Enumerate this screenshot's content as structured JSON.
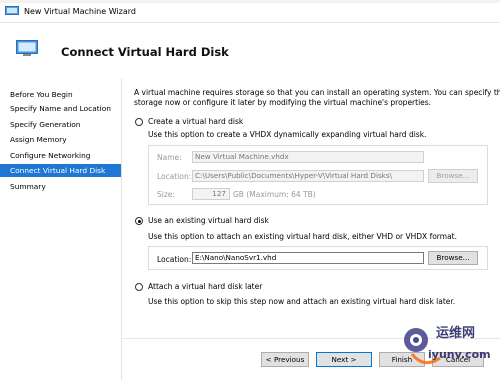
{
  "window": {
    "title": "New Virtual Machine Wizard",
    "top_strip_text": "... ... ...   ..."
  },
  "header": {
    "title": "Connect Virtual Hard Disk"
  },
  "nav": {
    "items": [
      {
        "label": "Before You Begin",
        "active": false
      },
      {
        "label": "Specify Name and Location",
        "active": false
      },
      {
        "label": "Specify Generation",
        "active": false
      },
      {
        "label": "Assign Memory",
        "active": false
      },
      {
        "label": "Configure Networking",
        "active": false
      },
      {
        "label": "Connect Virtual Hard Disk",
        "active": true
      },
      {
        "label": "Summary",
        "active": false
      }
    ]
  },
  "intro": {
    "line1": "A virtual machine requires storage so that you can install an operating system. You can specify the",
    "line2": "storage now or configure it later by modifying the virtual machine's properties."
  },
  "option_create": {
    "label": "Create a virtual hard disk",
    "description": "Use this option to create a VHDX dynamically expanding virtual hard disk.",
    "name_label": "Name:",
    "name_value": "New Virtual Machine.vhdx",
    "location_label": "Location:",
    "location_value": "C:\\Users\\Public\\Documents\\Hyper-V\\Virtual Hard Disks\\",
    "browse_label": "Browse...",
    "size_label": "Size:",
    "size_value": "127",
    "size_unit": "GB (Maximum: 64 TB)",
    "selected": false
  },
  "option_existing": {
    "label": "Use an existing virtual hard disk",
    "description": "Use this option to attach an existing virtual hard disk, either VHD or VHDX format.",
    "location_label": "Location:",
    "location_value": "E:\\Nano\\NanoSvr1.vhd",
    "browse_label": "Browse...",
    "selected": true
  },
  "option_later": {
    "label": "Attach a virtual hard disk later",
    "description": "Use this option to skip this step now and attach an existing virtual hard disk later.",
    "selected": false
  },
  "footer": {
    "previous_label": "< Previous",
    "next_label": "Next >",
    "finish_label": "Finish",
    "cancel_label": "Cancel"
  },
  "watermark": {
    "text_cn": "运维网",
    "text_url": "iyunv.com"
  }
}
